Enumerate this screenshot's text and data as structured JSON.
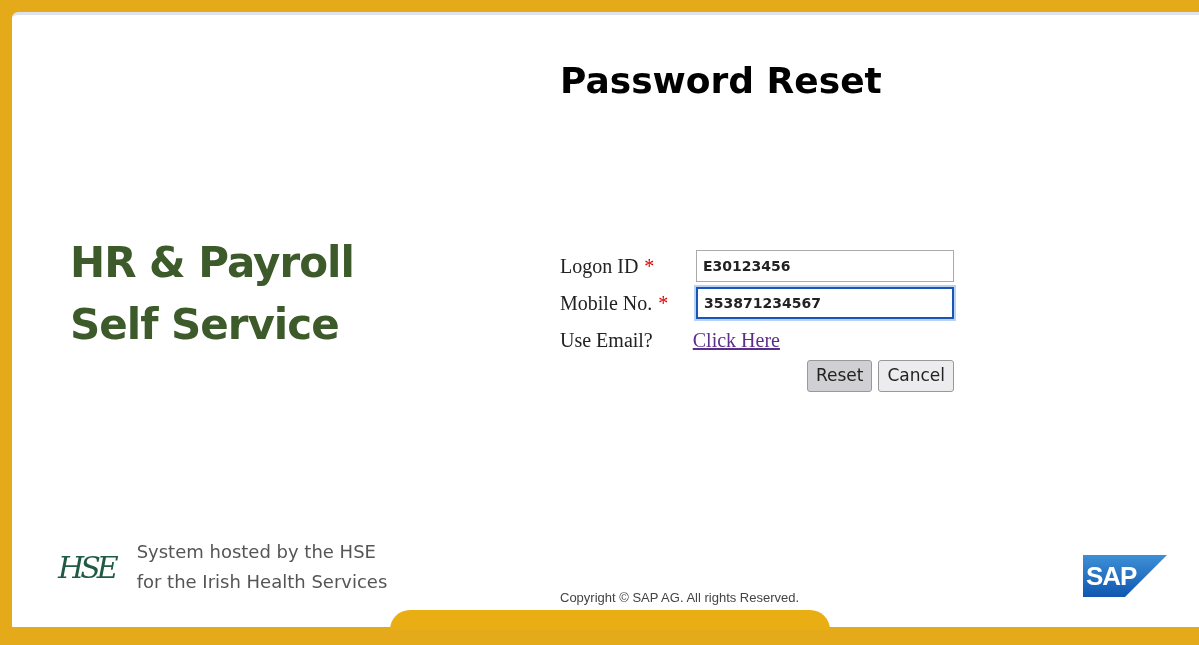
{
  "title": "Password Reset",
  "brand": {
    "line_1": "HR & Payroll",
    "line_2": "Self Service"
  },
  "form": {
    "fields": [
      {
        "label": "Logon ID",
        "required_mark": "*",
        "value": "E30123456",
        "focused": false
      },
      {
        "label": "Mobile No.",
        "required_mark": "*",
        "value": "353871234567",
        "focused": true
      }
    ],
    "email_prompt": "Use Email?",
    "email_link": "Click Here",
    "buttons": [
      {
        "label": "Reset",
        "kind": "primary"
      },
      {
        "label": "Cancel",
        "kind": "secondary"
      }
    ]
  },
  "footer": {
    "hse_logo": "HSE",
    "hosted_line_1": "System hosted by the HSE",
    "hosted_line_2": "for the Irish Health Services",
    "copyright": "Copyright © SAP AG. All rights Reserved.",
    "sap_logo": "SAP"
  }
}
